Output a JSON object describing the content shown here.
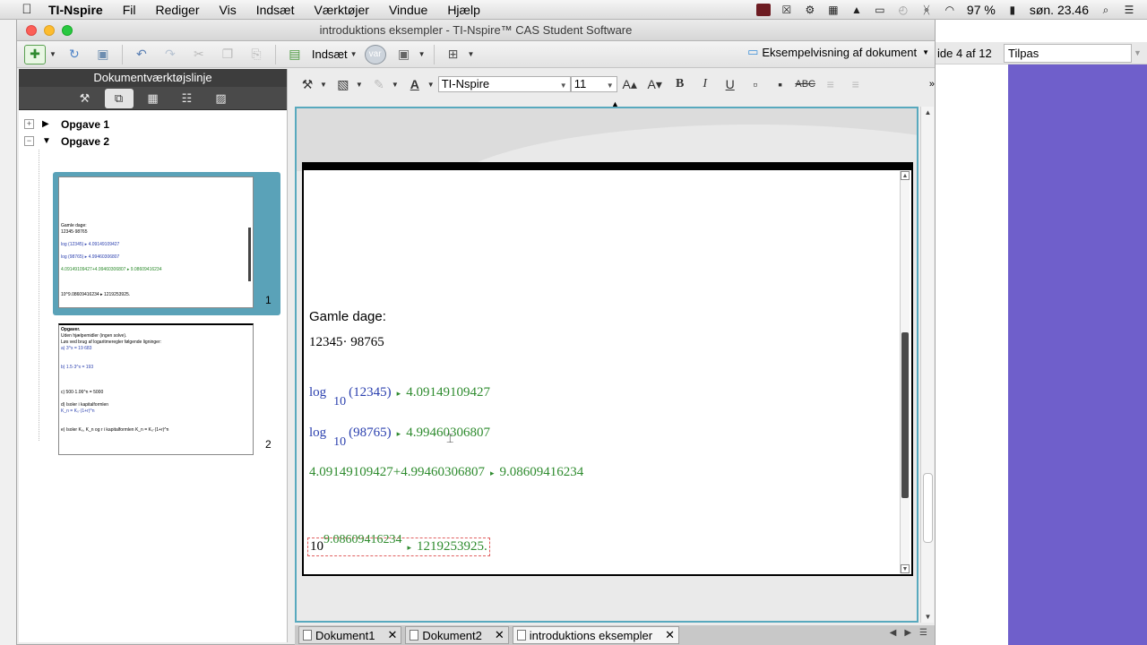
{
  "menubar": {
    "apple": "",
    "items": [
      "TI-Nspire",
      "Fil",
      "Rediger",
      "Vis",
      "Indsæt",
      "Værktøjer",
      "Vindue",
      "Hjælp"
    ],
    "battery": "97 %",
    "clock": "søn. 23.46"
  },
  "window": {
    "title": "introduktions eksempler - TI-Nspire™ CAS Student Software"
  },
  "toolbar1": {
    "insert_label": "Indsæt",
    "var_label": "var",
    "preview_label": "Eksempelvisning af dokument"
  },
  "background_app": {
    "page_indicator": "ide 4 af 12",
    "zoom_value": "Tilpas"
  },
  "left_panel": {
    "header": "Dokumentværktøjslinje",
    "problems": [
      {
        "label": "Opgave 1",
        "expanded": false
      },
      {
        "label": "Opgave 2",
        "expanded": true
      }
    ],
    "page_numbers": [
      "1",
      "2"
    ],
    "thumb1": {
      "line1": "Gamle dage:",
      "line2": "12345·98765",
      "line3": "log (12345) ▸ 4.09149109427",
      "line4": "log (98765) ▸ 4.99460306807",
      "line5": "4.09149109427+4.99460306807 ▸ 9.08609416234",
      "line6": "10^9.08609416234 ▸ 1219253925."
    },
    "thumb2": {
      "l1": "Opgaver.",
      "l2": "Uden hjælpemidler (ingen solve).",
      "l3": "Løs ved brug af logaritmeregler følgende ligninger:",
      "l4": "a) 3^x = 19 683",
      "l5": "b) 1.5·3^x = 193",
      "l6": "c) 500·1.06^n = 5000",
      "l7": "d) Isoler i kapitalformlen",
      "l8": "K_n = K₀·(1+r)^n",
      "l9": "e) Isoler K₀, K_n og r i kapitalformlen K_n = K₀·(1+r)^n"
    }
  },
  "toolbar2": {
    "font_name": "TI-Nspire",
    "font_size": "11"
  },
  "document": {
    "heading": "Gamle dage:",
    "product": "12345· 98765",
    "log1_fn": "log",
    "log1_base": "10",
    "log1_arg": "(12345)",
    "log1_result": "4.09149109427",
    "log2_fn": "log",
    "log2_base": "10",
    "log2_arg": "(98765)",
    "log2_result": "4.99460306807",
    "sum_expr": "4.09149109427+4.99460306807",
    "sum_result": "9.08609416234",
    "pow_base": "10",
    "pow_exp": "9.08609416234",
    "pow_result": "1219253925."
  },
  "bottom_tabs": [
    {
      "label": "Dokument1",
      "active": false
    },
    {
      "label": "Dokument2",
      "active": false
    },
    {
      "label": "introduktions eksempler",
      "active": true
    }
  ],
  "colors": {
    "accent_blue": "#58a9be",
    "result_green": "#2e8b2e",
    "input_blue": "#2a3fae",
    "purple_bg": "#6f5fcb"
  }
}
